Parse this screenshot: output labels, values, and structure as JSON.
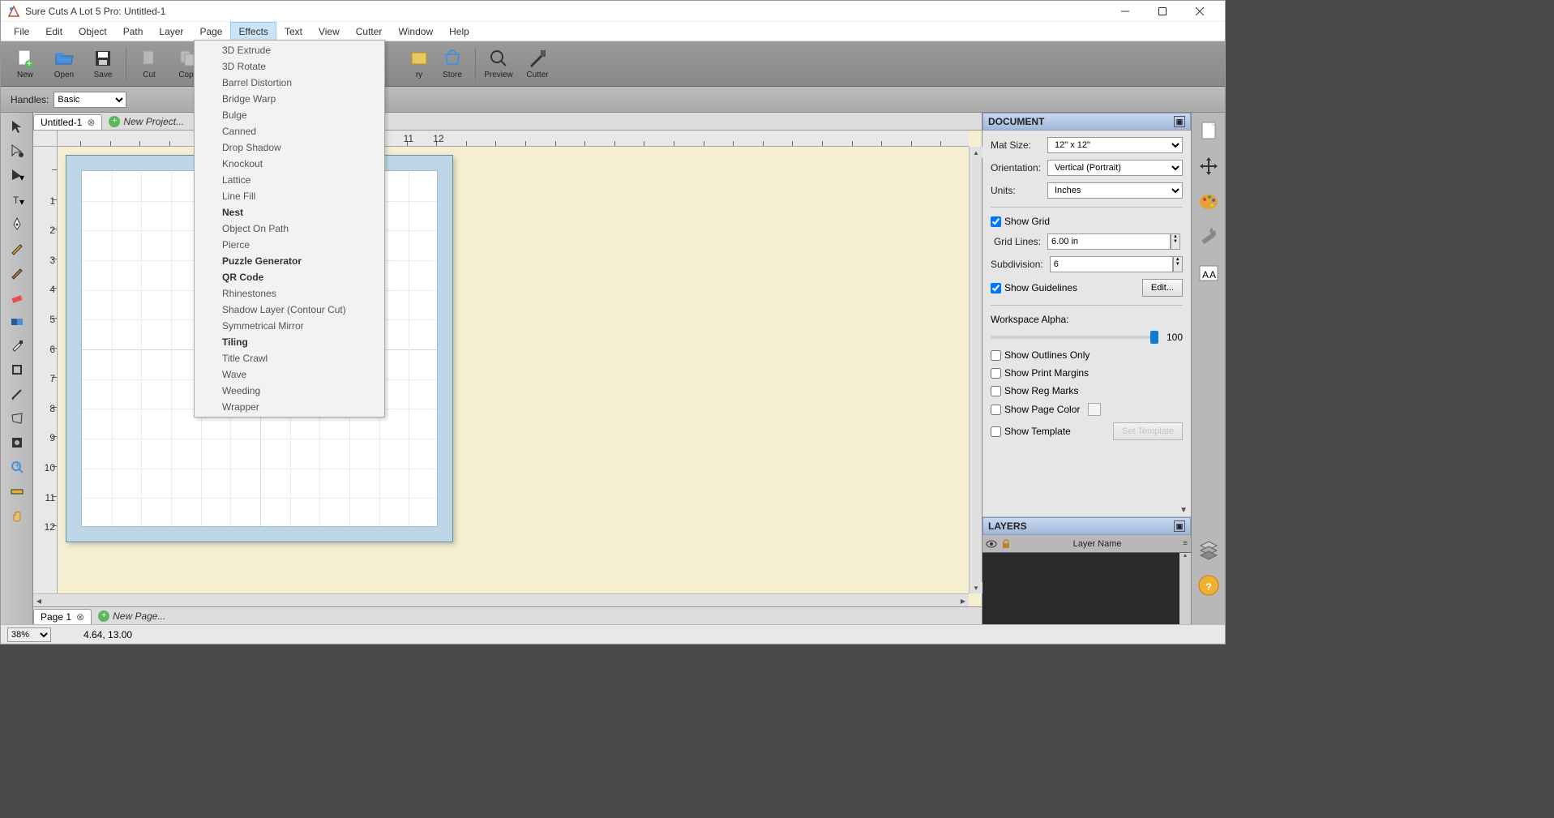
{
  "window": {
    "title": "Sure Cuts A Lot 5 Pro: Untitled-1"
  },
  "menubar": [
    "File",
    "Edit",
    "Object",
    "Path",
    "Layer",
    "Page",
    "Effects",
    "Text",
    "View",
    "Cutter",
    "Window",
    "Help"
  ],
  "active_menu": "Effects",
  "effects_menu": [
    {
      "label": "3D Extrude",
      "bold": false
    },
    {
      "label": "3D Rotate",
      "bold": false
    },
    {
      "label": "Barrel Distortion",
      "bold": false
    },
    {
      "label": "Bridge Warp",
      "bold": false
    },
    {
      "label": "Bulge",
      "bold": false
    },
    {
      "label": "Canned",
      "bold": false
    },
    {
      "label": "Drop Shadow",
      "bold": false
    },
    {
      "label": "Knockout",
      "bold": false
    },
    {
      "label": "Lattice",
      "bold": false
    },
    {
      "label": "Line Fill",
      "bold": false
    },
    {
      "label": "Nest",
      "bold": true
    },
    {
      "label": "Object On Path",
      "bold": false
    },
    {
      "label": "Pierce",
      "bold": false
    },
    {
      "label": "Puzzle Generator",
      "bold": true
    },
    {
      "label": "QR Code",
      "bold": true
    },
    {
      "label": "Rhinestones",
      "bold": false
    },
    {
      "label": "Shadow Layer (Contour Cut)",
      "bold": false
    },
    {
      "label": "Symmetrical Mirror",
      "bold": false
    },
    {
      "label": "Tiling",
      "bold": true
    },
    {
      "label": "Title Crawl",
      "bold": false
    },
    {
      "label": "Wave",
      "bold": false
    },
    {
      "label": "Weeding",
      "bold": false
    },
    {
      "label": "Wrapper",
      "bold": false
    }
  ],
  "toolbar": {
    "new": "New",
    "open": "Open",
    "save": "Save",
    "cut": "Cut",
    "copy": "Copy",
    "library": "ry",
    "store": "Store",
    "preview": "Preview",
    "cutter": "Cutter"
  },
  "options_bar": {
    "handles_label": "Handles:",
    "handles_value": "Basic"
  },
  "project_tabs": {
    "tab1": "Untitled-1",
    "new_project": "New Project..."
  },
  "page_tabs": {
    "page1": "Page 1",
    "new_page": "New Page..."
  },
  "ruler_h": [
    "11",
    "12"
  ],
  "ruler_v": [
    "1",
    "2",
    "3",
    "4",
    "5",
    "6",
    "7",
    "8",
    "9",
    "10",
    "11",
    "12"
  ],
  "doc_panel": {
    "title": "DOCUMENT",
    "mat_size_label": "Mat Size:",
    "mat_size_value": "12\" x 12\"",
    "orientation_label": "Orientation:",
    "orientation_value": "Vertical (Portrait)",
    "units_label": "Units:",
    "units_value": "Inches",
    "show_grid": "Show Grid",
    "grid_lines_label": "Grid Lines:",
    "grid_lines_value": "6.00 in",
    "subdivision_label": "Subdivision:",
    "subdivision_value": "6",
    "show_guidelines": "Show Guidelines",
    "edit_btn": "Edit...",
    "workspace_alpha_label": "Workspace Alpha:",
    "workspace_alpha_value": "100",
    "show_outlines": "Show Outlines Only",
    "show_print_margins": "Show Print Margins",
    "show_reg_marks": "Show Reg Marks",
    "show_page_color": "Show Page Color",
    "show_template": "Show Template",
    "set_template_btn": "Set Template"
  },
  "layers_panel": {
    "title": "LAYERS",
    "column": "Layer Name"
  },
  "statusbar": {
    "zoom": "38%",
    "coords": "4.64, 13.00"
  }
}
